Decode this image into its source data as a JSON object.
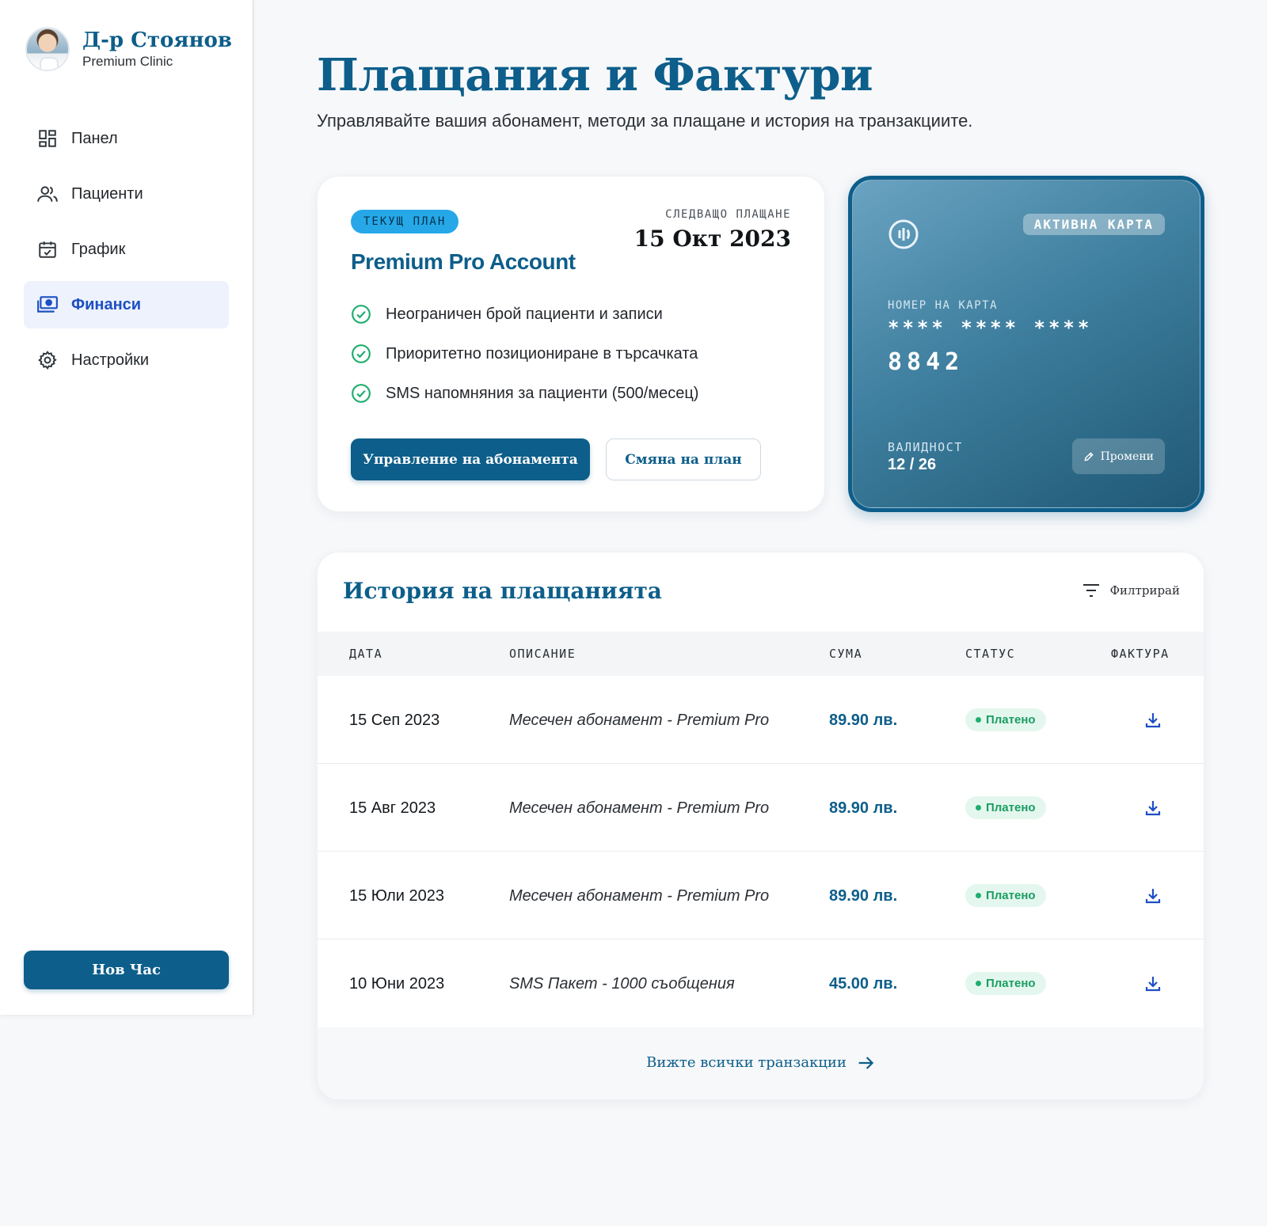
{
  "profile": {
    "name": "Д-р Стоянов",
    "clinic": "Premium Clinic"
  },
  "sidebar": {
    "items": [
      {
        "label": "Панел",
        "icon": "dashboard-icon"
      },
      {
        "label": "Пациенти",
        "icon": "users-icon"
      },
      {
        "label": "График",
        "icon": "calendar-check-icon"
      },
      {
        "label": "Финанси",
        "icon": "payments-icon",
        "active": true
      },
      {
        "label": "Настройки",
        "icon": "gear-icon"
      }
    ],
    "new_button": "Нов Час"
  },
  "header": {
    "title": "Плащания и Фактури",
    "subtitle": "Управлявайте вашия абонамент, методи за плащане и история на транзакциите."
  },
  "plan": {
    "badge": "ТЕКУЩ ПЛАН",
    "next_payment_label": "СЛЕДВАЩО ПЛАЩАНЕ",
    "next_payment_date": "15 Окт 2023",
    "name": "Premium Pro Account",
    "features": [
      "Неограничен брой пациенти и записи",
      "Приоритетно позициониране в търсачката",
      "SMS напомняния за пациенти (500/месец)"
    ],
    "manage_button": "Управление на абонамента",
    "change_button": "Смяна на план"
  },
  "card": {
    "status": "АКТИВНА КАРТА",
    "number_label": "НОМЕР НА КАРТА",
    "masked": "**** **** ****",
    "last4": "8842",
    "validity_label": "ВАЛИДНОСТ",
    "validity": "12 / 26",
    "edit_button": "Промени"
  },
  "history": {
    "title": "История на плащанията",
    "filter": "Филтрирай",
    "columns": [
      "ДАТА",
      "ОПИСАНИЕ",
      "СУМА",
      "СТАТУС",
      "ФАКТУРА"
    ],
    "rows": [
      {
        "date": "15 Сеп 2023",
        "description": "Месечен абонамент - Premium Pro",
        "amount": "89.90 лв.",
        "status": "Платено"
      },
      {
        "date": "15 Авг 2023",
        "description": "Месечен абонамент - Premium Pro",
        "amount": "89.90 лв.",
        "status": "Платено"
      },
      {
        "date": "15 Юли 2023",
        "description": "Месечен абонамент - Premium Pro",
        "amount": "89.90 лв.",
        "status": "Платено"
      },
      {
        "date": "10 Юни 2023",
        "description": "SMS Пакет - 1000 съобщения",
        "amount": "45.00 лв.",
        "status": "Платено"
      }
    ],
    "view_all": "Вижте всички транзакции"
  },
  "colors": {
    "primary": "#0d5e8a",
    "active_nav": "#1d4fc2",
    "success": "#1fae6e",
    "badge": "#26a8e8"
  }
}
